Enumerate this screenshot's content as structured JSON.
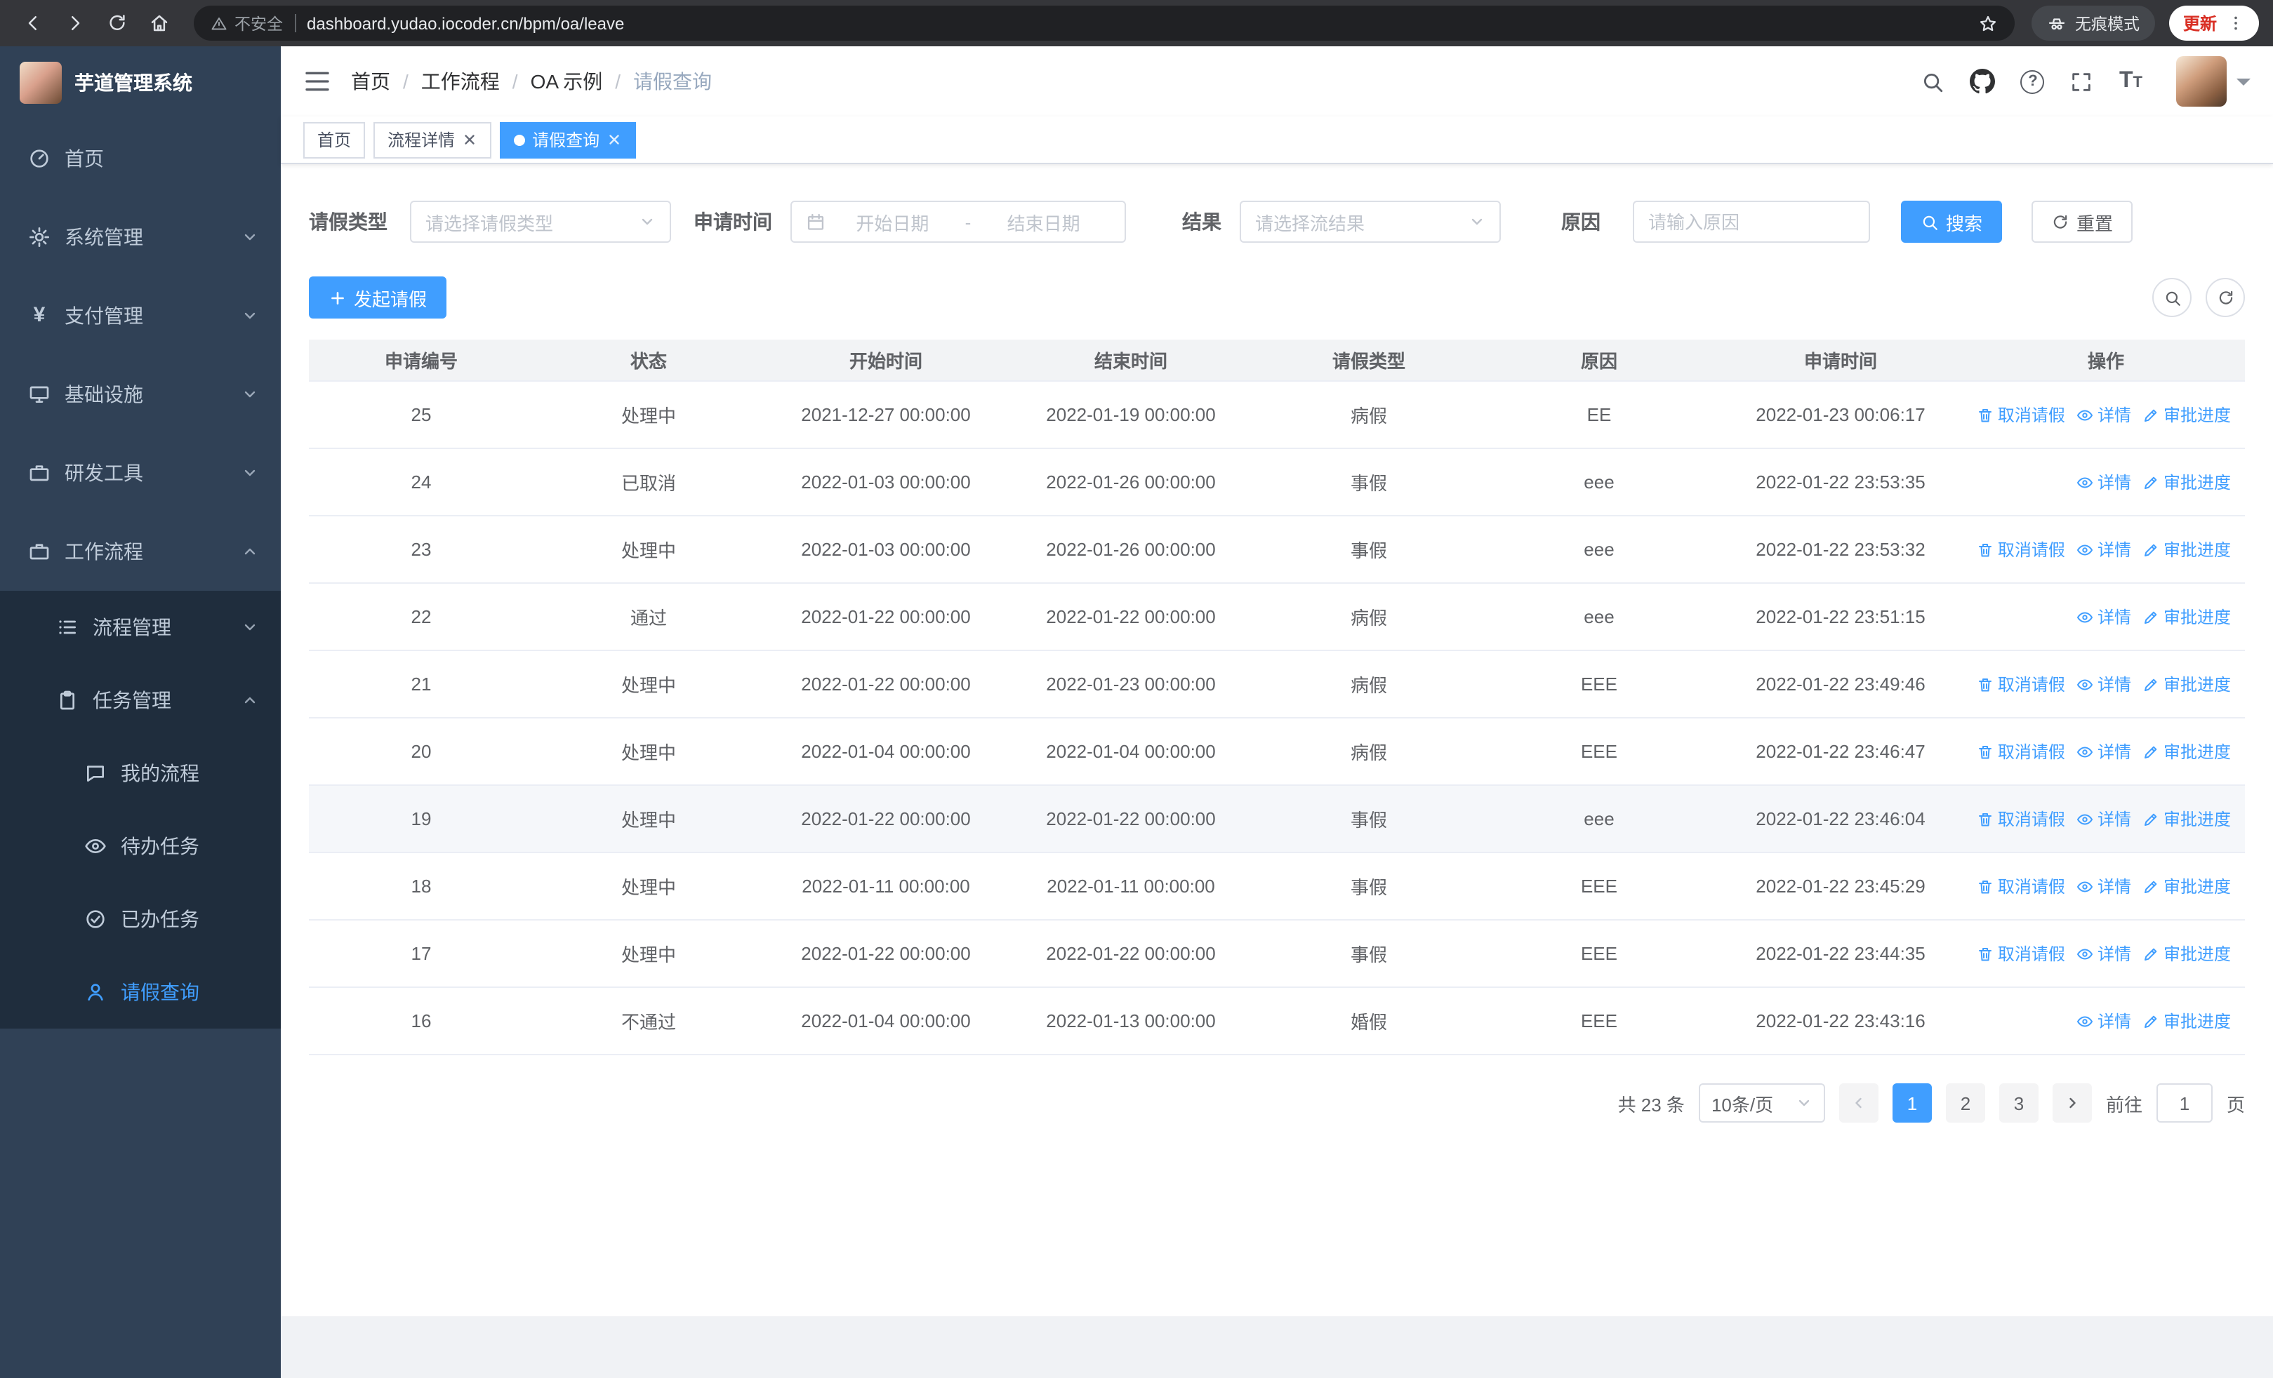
{
  "browser": {
    "security_label": "不安全",
    "url": "dashboard.yudao.iocoder.cn/bpm/oa/leave",
    "incognito_label": "无痕模式",
    "update_label": "更新"
  },
  "sidebar": {
    "app_title": "芋道管理系统",
    "items": [
      {
        "label": "首页"
      },
      {
        "label": "系统管理"
      },
      {
        "label": "支付管理"
      },
      {
        "label": "基础设施"
      },
      {
        "label": "研发工具"
      },
      {
        "label": "工作流程"
      }
    ],
    "submenu": [
      {
        "label": "流程管理"
      },
      {
        "label": "任务管理"
      }
    ],
    "task_children": [
      {
        "label": "我的流程"
      },
      {
        "label": "待办任务"
      },
      {
        "label": "已办任务"
      },
      {
        "label": "请假查询"
      }
    ]
  },
  "navbar": {
    "breadcrumb": [
      "首页",
      "工作流程",
      "OA 示例",
      "请假查询"
    ],
    "separator": "/"
  },
  "tabs": [
    {
      "label": "首页"
    },
    {
      "label": "流程详情"
    },
    {
      "label": "请假查询"
    }
  ],
  "filters": {
    "leave_type_label": "请假类型",
    "leave_type_placeholder": "请选择请假类型",
    "apply_time_label": "申请时间",
    "start_date_placeholder": "开始日期",
    "range_separator": "-",
    "end_date_placeholder": "结束日期",
    "result_label": "结果",
    "result_placeholder": "请选择流结果",
    "reason_label": "原因",
    "reason_placeholder": "请输入原因",
    "search_label": "搜索",
    "reset_label": "重置"
  },
  "toolbar": {
    "create_label": "发起请假"
  },
  "table": {
    "headers": [
      "申请编号",
      "状态",
      "开始时间",
      "结束时间",
      "请假类型",
      "原因",
      "申请时间",
      "操作"
    ],
    "rows": [
      {
        "id": "25",
        "status": "处理中",
        "start": "2021-12-27 00:00:00",
        "end": "2022-01-19 00:00:00",
        "type": "病假",
        "reason": "EE",
        "applied": "2022-01-23 00:06:17"
      },
      {
        "id": "24",
        "status": "已取消",
        "start": "2022-01-03 00:00:00",
        "end": "2022-01-26 00:00:00",
        "type": "事假",
        "reason": "eee",
        "applied": "2022-01-22 23:53:35"
      },
      {
        "id": "23",
        "status": "处理中",
        "start": "2022-01-03 00:00:00",
        "end": "2022-01-26 00:00:00",
        "type": "事假",
        "reason": "eee",
        "applied": "2022-01-22 23:53:32"
      },
      {
        "id": "22",
        "status": "通过",
        "start": "2022-01-22 00:00:00",
        "end": "2022-01-22 00:00:00",
        "type": "病假",
        "reason": "eee",
        "applied": "2022-01-22 23:51:15"
      },
      {
        "id": "21",
        "status": "处理中",
        "start": "2022-01-22 00:00:00",
        "end": "2022-01-23 00:00:00",
        "type": "病假",
        "reason": "EEE",
        "applied": "2022-01-22 23:49:46"
      },
      {
        "id": "20",
        "status": "处理中",
        "start": "2022-01-04 00:00:00",
        "end": "2022-01-04 00:00:00",
        "type": "病假",
        "reason": "EEE",
        "applied": "2022-01-22 23:46:47"
      },
      {
        "id": "19",
        "status": "处理中",
        "start": "2022-01-22 00:00:00",
        "end": "2022-01-22 00:00:00",
        "type": "事假",
        "reason": "eee",
        "applied": "2022-01-22 23:46:04"
      },
      {
        "id": "18",
        "status": "处理中",
        "start": "2022-01-11 00:00:00",
        "end": "2022-01-11 00:00:00",
        "type": "事假",
        "reason": "EEE",
        "applied": "2022-01-22 23:45:29"
      },
      {
        "id": "17",
        "status": "处理中",
        "start": "2022-01-22 00:00:00",
        "end": "2022-01-22 00:00:00",
        "type": "事假",
        "reason": "EEE",
        "applied": "2022-01-22 23:44:35"
      },
      {
        "id": "16",
        "status": "不通过",
        "start": "2022-01-04 00:00:00",
        "end": "2022-01-13 00:00:00",
        "type": "婚假",
        "reason": "EEE",
        "applied": "2022-01-22 23:43:16"
      }
    ]
  },
  "ops": {
    "cancel": "取消请假",
    "detail": "详情",
    "progress": "审批进度"
  },
  "pagination": {
    "total": "共 23 条",
    "page_size": "10条/页",
    "pages": [
      "1",
      "2",
      "3"
    ],
    "goto_prefix": "前往",
    "goto_value": "1",
    "goto_suffix": "页"
  },
  "colors": {
    "accent": "#409eff",
    "sidebar_bg": "#304156",
    "submenu_bg": "#1f2d3d",
    "update_red": "#d93025"
  }
}
